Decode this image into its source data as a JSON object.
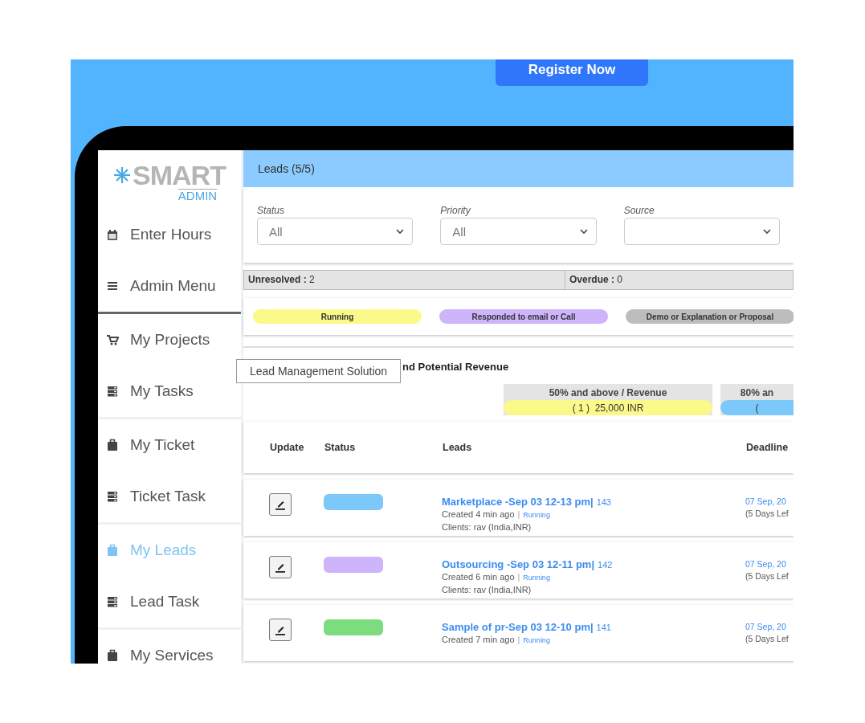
{
  "banner": {
    "button": "Register Now"
  },
  "sidebar": {
    "logo": {
      "word": "SMART",
      "sub": "ADMIN"
    },
    "sections": [
      {
        "items": [
          {
            "label": "Enter Hours",
            "kind": "calendar",
            "selected": false
          },
          {
            "label": "Admin Menu",
            "kind": "menu",
            "selected": false
          }
        ]
      },
      {
        "items": [
          {
            "label": "My Projects",
            "kind": "cart",
            "selected": false
          },
          {
            "label": "My Tasks",
            "kind": "list",
            "selected": false
          }
        ]
      },
      {
        "items": [
          {
            "label": "My Ticket",
            "kind": "case",
            "selected": false
          },
          {
            "label": "Ticket Task",
            "kind": "list",
            "selected": false
          }
        ]
      },
      {
        "items": [
          {
            "label": "My Leads",
            "kind": "case",
            "selected": true
          },
          {
            "label": "Lead Task",
            "kind": "list",
            "selected": false
          }
        ]
      },
      {
        "items": [
          {
            "label": "My Services",
            "kind": "case",
            "selected": false
          }
        ]
      }
    ]
  },
  "header": {
    "title": "Leads (5/5)"
  },
  "filters": [
    {
      "label": "Status",
      "value": "All"
    },
    {
      "label": "Priority",
      "value": "All"
    },
    {
      "label": "Source"
    }
  ],
  "summary": [
    {
      "text": "**Unresolved :** 2"
    },
    {
      "text": "**Overdue :** 0"
    }
  ],
  "legend": [
    {
      "label": "Running",
      "color": "#fbf98a"
    },
    {
      "label": "Responded to email or Call",
      "color": "#cdb4fb"
    },
    {
      "label": "Demo or Explanation or Proposal",
      "color": "#bdbdbd"
    }
  ],
  "tooltip": "Lead Management Solution",
  "revenue": {
    "title": "nd Potential Revenue",
    "columns": [
      {
        "heading": "50% and above / Revenue",
        "value": "( 1 )  25,000 INR",
        "color": "#fbf98a"
      },
      {
        "heading": "80% an",
        "value": "(",
        "color": "#7cc8fb"
      }
    ]
  },
  "table": {
    "columns": [
      "Update",
      "Status",
      "Leads",
      "Deadline"
    ],
    "rows": [
      {
        "color": "#7cc8fb",
        "title": "Marketplace -Sep 03 12-13 pm|",
        "id": "143",
        "created": "Created 4 min ago",
        "separator": "|",
        "stage": "Running",
        "clients": "Clients: rav (India,INR)",
        "deadline": "07 Sep, 20",
        "days_left": "(5 Days Lef"
      },
      {
        "color": "#cdb4fb",
        "title": "Outsourcing -Sep 03 12-11 pm|",
        "id": "142",
        "created": "Created 6 min ago",
        "separator": "|",
        "stage": "Running",
        "clients": "Clients: rav (India,INR)",
        "deadline": "07 Sep, 20",
        "days_left": "(5 Days Lef"
      },
      {
        "color": "#7ddc7e",
        "title": "Sample of pr-Sep 03 12-10 pm|",
        "id": "141",
        "created": "Created 7 min ago",
        "separator": "|",
        "stage": "Running",
        "deadline": "07 Sep, 20",
        "days_left": "(5 Days Lef"
      }
    ]
  }
}
